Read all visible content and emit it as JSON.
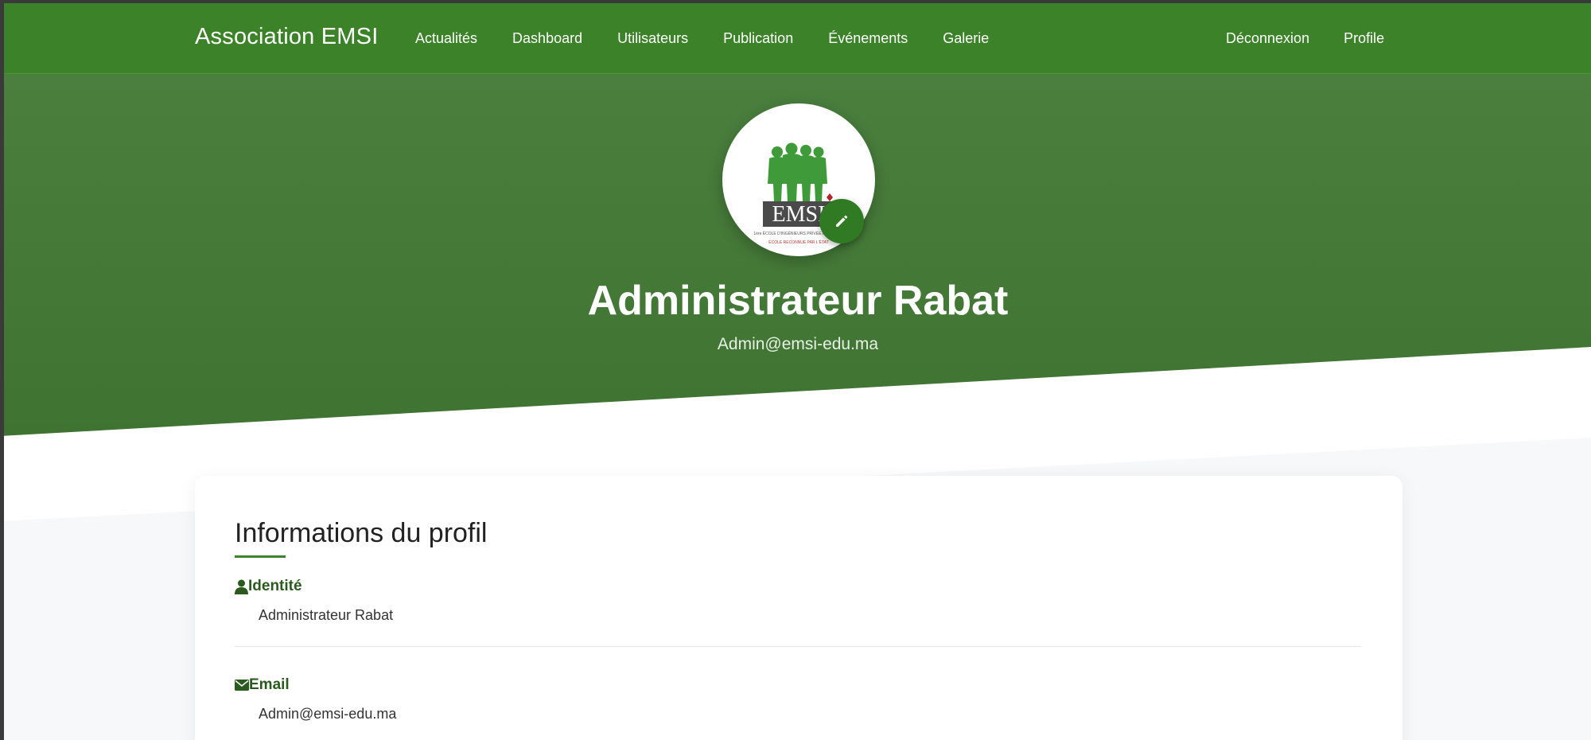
{
  "navbar": {
    "brand": "Association EMSI",
    "links": [
      "Actualités",
      "Dashboard",
      "Utilisateurs",
      "Publication",
      "Événements",
      "Galerie"
    ],
    "right_links": [
      "Déconnexion",
      "Profile"
    ]
  },
  "hero": {
    "name": "Administrateur Rabat",
    "email": "Admin@emsi-edu.ma",
    "avatar_logo_text": "EMSI",
    "avatar_logo_caption": "1ère ÉCOLE D'INGÉNIEURS PRIVÉE AU MAROC",
    "avatar_logo_subcaption": "ÉCOLE RECONNUE PAR L'ÉTAT"
  },
  "profile_card": {
    "title": "Informations du profil",
    "fields": [
      {
        "label": "Identité",
        "value": "Administrateur Rabat",
        "icon": "user-icon"
      },
      {
        "label": "Email",
        "value": "Admin@emsi-edu.ma",
        "icon": "envelope-icon"
      }
    ]
  },
  "colors": {
    "primary_green": "#3b8228",
    "hero_green": "#4a7f3e",
    "label_green": "#2b5a1f",
    "edit_button": "#2f7a22"
  }
}
